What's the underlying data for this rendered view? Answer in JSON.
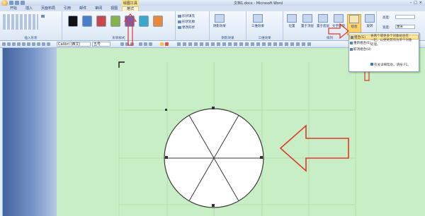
{
  "window": {
    "title": "文档1.docx - Microsoft Word",
    "context_tab_title": "绘图工具",
    "controls": [
      "–",
      "□",
      "×"
    ]
  },
  "tabs": [
    {
      "label": "开始"
    },
    {
      "label": "插入"
    },
    {
      "label": "页面布局"
    },
    {
      "label": "引用"
    },
    {
      "label": "邮件"
    },
    {
      "label": "审阅"
    },
    {
      "label": "视图"
    },
    {
      "label": "格式"
    }
  ],
  "ribbon": {
    "groups": {
      "insert_shapes": "插入形状",
      "shape_styles": "形状样式",
      "shadow": "阴影效果",
      "three_d": "三维效果",
      "arrange": "排列",
      "size": "大小"
    },
    "shape_fill": "形状填充",
    "shape_outline": "形状轮廓",
    "change_shape": "更改形状",
    "shadow_btn": "阴影效果",
    "three_d_btn": "三维效果",
    "position_btn": "位置",
    "front_btn": "置于顶层",
    "back_btn": "置于底层",
    "wrap_btn": "文字环绕",
    "group_btn": "组合",
    "rotate_btn": "旋转",
    "height_label": "高度:",
    "width_label": "宽度:",
    "height_value": "",
    "width_value": "厘米"
  },
  "fmtbar": {
    "font": "Calibri (西文)",
    "size": "五号"
  },
  "dropdown": {
    "items": [
      "组合(G)",
      "重新组合(E)",
      "取消组合(U)"
    ],
    "tooltip_line1": "将两个或更多个对象组合在",
    "tooltip_line2": "一起，以便将其作为单个对象",
    "tooltip_line3": "处理。",
    "help": "有关详细帮助，请按 F1。"
  },
  "colors": {
    "page_bg": "#c7eec4",
    "accent_arrow": "#e0392b",
    "swatches": [
      "#111111",
      "#4a7fc8",
      "#c84a48",
      "#86b24c",
      "#7d5ca8",
      "#3aa8c6",
      "#e8893a"
    ]
  }
}
